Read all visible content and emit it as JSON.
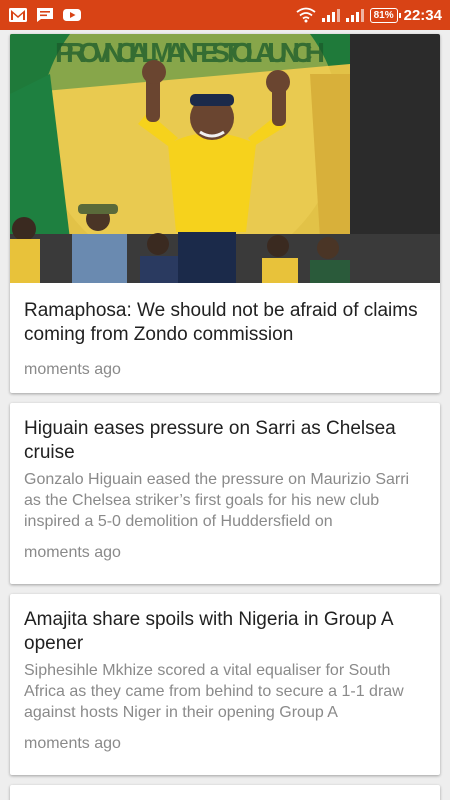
{
  "status_bar": {
    "battery": "81%",
    "time": "22:34"
  },
  "articles": [
    {
      "title": "Ramaphosa: We should not be afraid of claims coming from Zondo commission",
      "summary": "",
      "time": "moments ago",
      "image_banner_text": "PROVINCIAL MANIFESTO LAUNCH"
    },
    {
      "title": "Higuain eases pressure on Sarri as Chelsea cruise",
      "summary": "Gonzalo Higuain eased the pressure on Maurizio Sarri as the Chelsea striker’s first goals for his new club inspired a 5-0 demolition of Huddersfield on",
      "time": "moments ago"
    },
    {
      "title": "Amajita share spoils with Nigeria in Group A opener",
      "summary": "Siphesihle Mkhize scored a vital equaliser for South Africa as they came from behind to secure a 1-1 draw against hosts Niger in their opening Group A",
      "time": "moments ago"
    }
  ],
  "colors": {
    "status_bar": "#d84315",
    "title_text": "#212121",
    "muted_text": "#8a8a8a",
    "background": "#eeeeee"
  }
}
